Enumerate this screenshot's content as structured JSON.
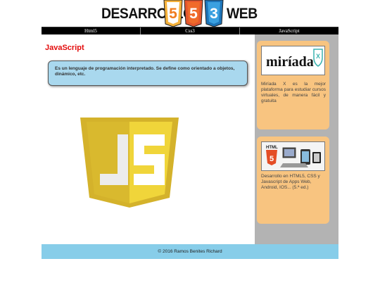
{
  "header": {
    "logo_left": "DESARROLLO",
    "logo_right": "WEB",
    "logo_badges": [
      "5",
      "5",
      "3"
    ]
  },
  "nav": {
    "items": [
      {
        "label": "Html5"
      },
      {
        "label": "Css3"
      },
      {
        "label": "JavaScript"
      }
    ]
  },
  "main": {
    "title": "JavaScript",
    "description": "Es un lenguaje de programación interpretado. Se define como orientado a objetos, dinámico, etc.",
    "logo_letters": "JS"
  },
  "sidebar": {
    "cards": [
      {
        "logo_text": "miríada",
        "logo_badge": "X",
        "text": "Miríada X es la mejor plataforma para estudiar cursos virtuales, de manera fácil y gratuita"
      },
      {
        "logo_text": "HTML",
        "logo_badge": "5",
        "text": "Desarrollo en HTML5, CSS y Javascript de Apps Web, Android, IOS... (5.ª ed.)"
      }
    ]
  },
  "footer": {
    "text": "© 2016 Ramos Benites Richard"
  },
  "colors": {
    "title_red": "#e30b0b",
    "nav_bg": "#000000",
    "desc_bg": "#a9d8ee",
    "sidebar_bg": "#b3b3b3",
    "card_bg": "#f8c480",
    "footer_bg": "#87cde9",
    "js_yellow": "#f0d53a",
    "js_yellow_dark": "#d4b22b"
  }
}
